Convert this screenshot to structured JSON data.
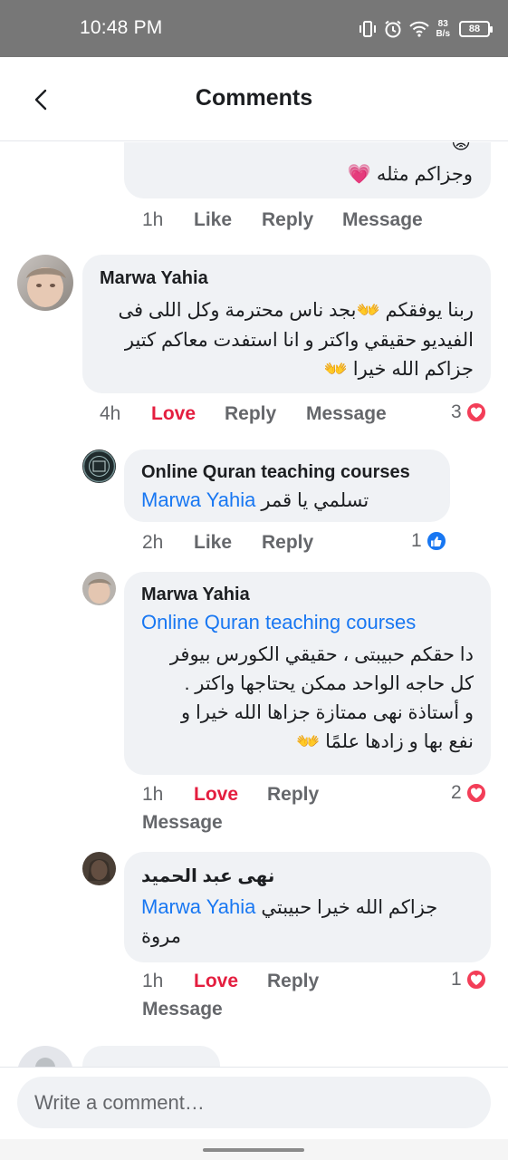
{
  "status_bar": {
    "time": "10:48 PM",
    "net_speed_value": "83",
    "net_speed_unit": "B/s",
    "battery": "88",
    "icons": [
      "vibrate-icon",
      "alarm-icon",
      "wifi-icon",
      "battery-icon"
    ]
  },
  "header": {
    "title": "Comments",
    "back_icon": "chevron-left-icon"
  },
  "comments": [
    {
      "id": "c0",
      "text": "وجزاكم مثله 💗",
      "emoji_top": "😟",
      "time": "1h",
      "actions": [
        "Like",
        "Reply",
        "Message"
      ]
    },
    {
      "id": "c1",
      "author": "Marwa Yahia",
      "text_lines": [
        "ربنا يوفقكم 👐بجد ناس محترمة وكل اللى فى",
        "الفيديو حقيقي واكتر و انا استفدت معاكم كتير",
        "جزاكم الله خيرا 👐"
      ],
      "time": "4h",
      "reaction_label": "Love",
      "actions": [
        "Reply",
        "Message"
      ],
      "reaction_count": "3"
    },
    {
      "id": "c2",
      "author": "Online Quran teaching courses",
      "mention": "Marwa Yahia",
      "text": "تسلمي يا قمر",
      "time": "2h",
      "actions": [
        "Like",
        "Reply"
      ],
      "reaction_count": "1"
    },
    {
      "id": "c3",
      "author": "Marwa Yahia",
      "mention": "Online Quran teaching courses",
      "text_lines": [
        "دا حقكم حبيبتى ، حقيقي الكورس بيوفر",
        "كل حاجه الواحد ممكن يحتاجها واكتر .",
        "و أستاذة نهى ممتازة جزاها الله خيرا و",
        "نفع بها و زادها علمًا 👐"
      ],
      "time": "1h",
      "reaction_label": "Love",
      "actions": [
        "Reply",
        "Message"
      ],
      "reaction_count": "2"
    },
    {
      "id": "c4",
      "author": "نهى عبد الحميد",
      "mention": "Marwa Yahia",
      "text_line1": "جزاكم الله خيرا حبيبتي",
      "text_line2": "مروة",
      "time": "1h",
      "reaction_label": "Love",
      "actions": [
        "Reply",
        "Message"
      ],
      "reaction_count": "1"
    }
  ],
  "composer": {
    "placeholder": "Write a comment…"
  }
}
